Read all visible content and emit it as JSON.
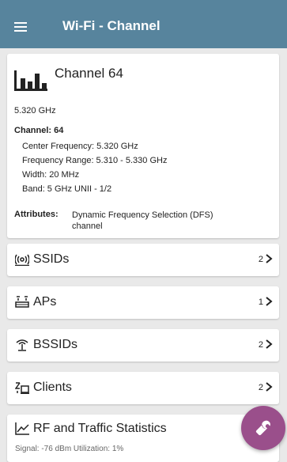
{
  "appbar": {
    "title": "Wi-Fi - Channel",
    "menu_icon": "hamburger-menu-icon"
  },
  "detail": {
    "icon": "signal-bars-icon",
    "title": "Channel 64",
    "frequency": "5.320 GHz",
    "channel_label": "Channel:",
    "channel_value": "64",
    "center_frequency": "Center Frequency:  5.320 GHz",
    "frequency_range": "Frequency Range:  5.310 - 5.330 GHz",
    "width": "Width:  20 MHz",
    "band": "Band:  5 GHz UNII - 1/2",
    "attributes_label": "Attributes:",
    "attributes_value": "Dynamic Frequency Selection (DFS) channel"
  },
  "nav": [
    {
      "label": "SSIDs",
      "count": "2",
      "icon": "wifi-broadcast-icon"
    },
    {
      "label": "APs",
      "count": "1",
      "icon": "access-point-icon"
    },
    {
      "label": "BSSIDs",
      "count": "2",
      "icon": "antenna-icon"
    },
    {
      "label": "Clients",
      "count": "2",
      "icon": "clients-devices-icon"
    },
    {
      "label": "RF and Traffic Statistics",
      "subtitle": "Signal: -76 dBm   Utilization: 1%",
      "icon": "line-chart-icon"
    }
  ],
  "fab": {
    "icon": "wrench-icon"
  },
  "colors": {
    "appbar": "#57849d",
    "fab": "#9a4f8b"
  }
}
